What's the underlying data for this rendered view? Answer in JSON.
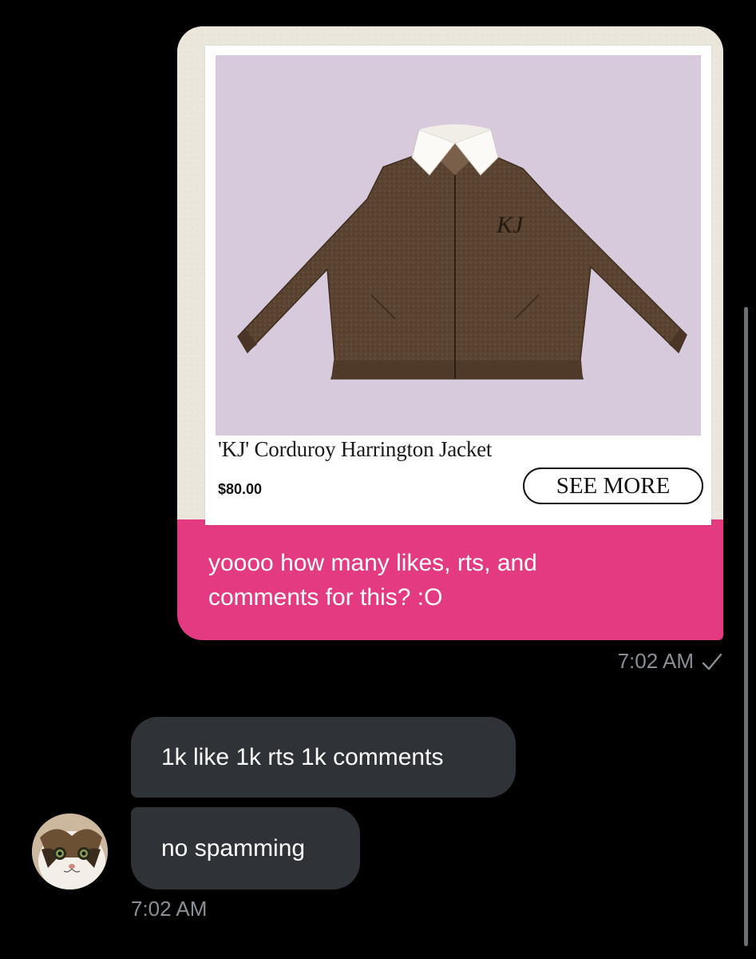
{
  "conversation": {
    "sent_message": {
      "product": {
        "name": "'KJ' Corduroy Harrington Jacket",
        "price": "$80.00",
        "cta_label": "SEE MORE",
        "logo_monogram": "KJ"
      },
      "text_lines": [
        "yoooo how many likes, rts, and",
        "comments for this? :O"
      ],
      "time": "7:02 AM",
      "status_icon": "checkmark-icon"
    },
    "received_messages": [
      {
        "text": "1k like 1k rts 1k comments"
      },
      {
        "text": "no spamming"
      }
    ],
    "received_time": "7:02 AM",
    "avatar_icon": "cat-avatar"
  },
  "colors": {
    "background": "#000000",
    "sent_bubble": "#e33a82",
    "received_bubble": "#2f3236",
    "timestamp": "#8a8f95",
    "product_bg": "#d8cadd",
    "jacket": "#5a4330"
  }
}
